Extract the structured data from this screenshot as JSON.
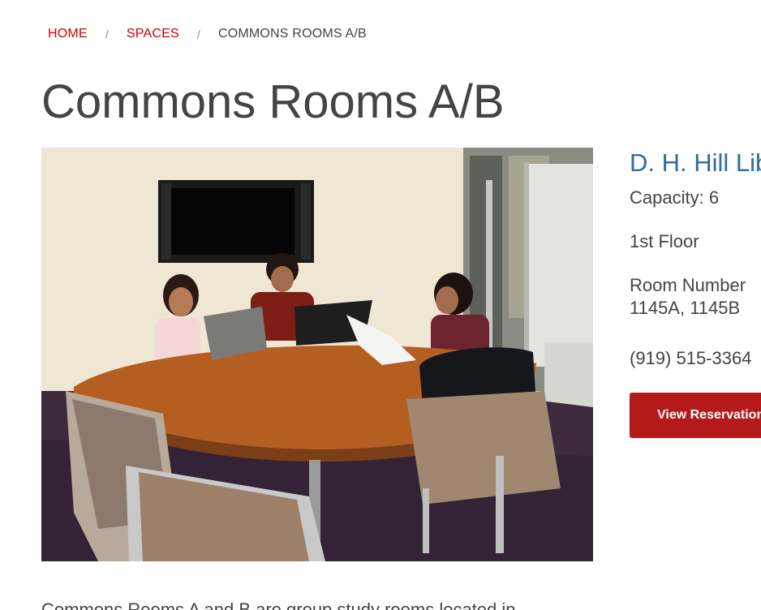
{
  "breadcrumb": {
    "home": "HOME",
    "spaces": "SPACES",
    "current": "COMMONS ROOMS A/B",
    "separator": "/"
  },
  "page_title": "Commons Rooms A/B",
  "photo": {
    "alt": "Students working with laptops at a wooden table in Commons Room"
  },
  "sidebar": {
    "library": "D. H. Hill Library",
    "capacity": "Capacity: 6",
    "floor": "1st Floor",
    "room_label": "Room Number",
    "room_numbers": "1145A, 1145B",
    "phone": "(919) 515-3364",
    "reserve_button": "View Reservations"
  },
  "description": "Commons Rooms A and B are group study rooms located in",
  "colors": {
    "link_red": "#cc0000",
    "library_blue": "#2f6c9f",
    "button_red": "#b51a1a",
    "text_gray": "#444444"
  }
}
